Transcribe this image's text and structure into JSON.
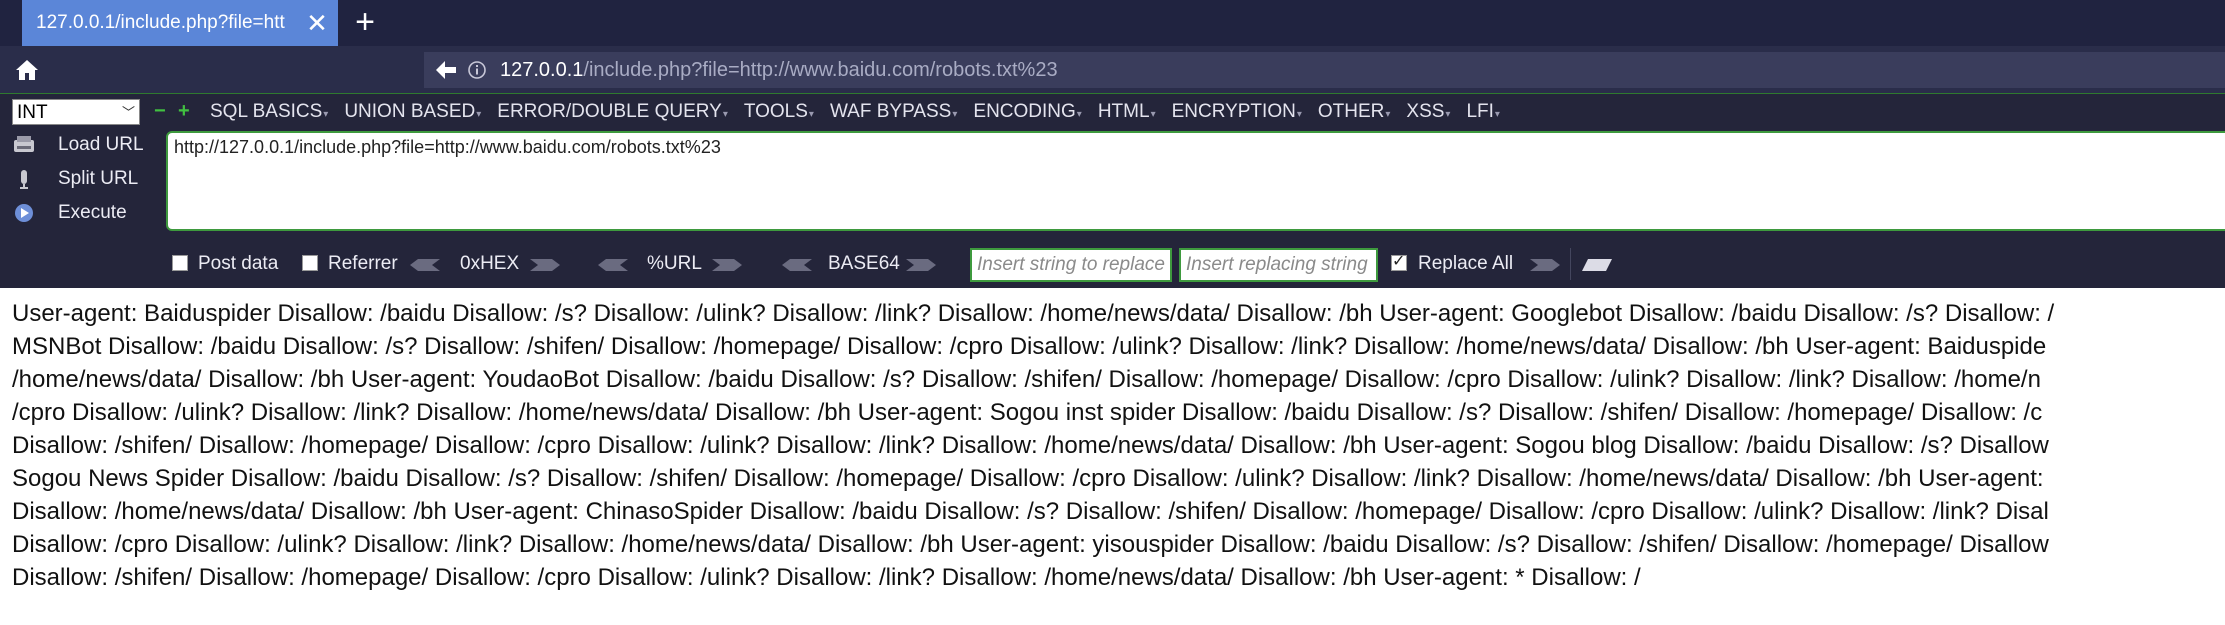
{
  "tab": {
    "title": "127.0.0.1/include.php?file=htt",
    "close": "✕"
  },
  "newtab": "+",
  "nav": {
    "url_host": "127.0.0.1",
    "url_path": "/include.php?file=http://www.baidu.com/robots.txt%23"
  },
  "hackbar": {
    "select_value": "INT",
    "minus": "−",
    "plus": "+",
    "menus": [
      "SQL BASICS",
      "UNION BASED",
      "ERROR/DOUBLE QUERY",
      "TOOLS",
      "WAF BYPASS",
      "ENCODING",
      "HTML",
      "ENCRYPTION",
      "OTHER",
      "XSS",
      "LFI"
    ],
    "load_url": "Load URL",
    "split_url": "Split URL",
    "execute": "Execute",
    "url_value": "http://127.0.0.1/include.php?file=http://www.baidu.com/robots.txt%23",
    "post_data": "Post data",
    "referrer": "Referrer",
    "hex": "0xHEX",
    "url_enc": "%URL",
    "base64": "BASE64",
    "replace_placeholder": "Insert string to replace",
    "replacing_placeholder": "Insert replacing string",
    "replace_all": "Replace All",
    "post_checked": false,
    "referrer_checked": false,
    "replace_all_checked": true
  },
  "content": {
    "lines": [
      "User-agent: Baiduspider Disallow: /baidu Disallow: /s? Disallow: /ulink? Disallow: /link? Disallow: /home/news/data/ Disallow: /bh User-agent: Googlebot Disallow: /baidu Disallow: /s? Disallow: /",
      "MSNBot Disallow: /baidu Disallow: /s? Disallow: /shifen/ Disallow: /homepage/ Disallow: /cpro Disallow: /ulink? Disallow: /link? Disallow: /home/news/data/ Disallow: /bh User-agent: Baiduspide",
      "/home/news/data/ Disallow: /bh User-agent: YoudaoBot Disallow: /baidu Disallow: /s? Disallow: /shifen/ Disallow: /homepage/ Disallow: /cpro Disallow: /ulink? Disallow: /link? Disallow: /home/n",
      "/cpro Disallow: /ulink? Disallow: /link? Disallow: /home/news/data/ Disallow: /bh User-agent: Sogou inst spider Disallow: /baidu Disallow: /s? Disallow: /shifen/ Disallow: /homepage/ Disallow: /c",
      "Disallow: /shifen/ Disallow: /homepage/ Disallow: /cpro Disallow: /ulink? Disallow: /link? Disallow: /home/news/data/ Disallow: /bh User-agent: Sogou blog Disallow: /baidu Disallow: /s? Disallow",
      "Sogou News Spider Disallow: /baidu Disallow: /s? Disallow: /shifen/ Disallow: /homepage/ Disallow: /cpro Disallow: /ulink? Disallow: /link? Disallow: /home/news/data/ Disallow: /bh User-agent:",
      "Disallow: /home/news/data/ Disallow: /bh User-agent: ChinasoSpider Disallow: /baidu Disallow: /s? Disallow: /shifen/ Disallow: /homepage/ Disallow: /cpro Disallow: /ulink? Disallow: /link? Disal",
      "Disallow: /cpro Disallow: /ulink? Disallow: /link? Disallow: /home/news/data/ Disallow: /bh User-agent: yisouspider Disallow: /baidu Disallow: /s? Disallow: /shifen/ Disallow: /homepage/ Disallow",
      "Disallow: /shifen/ Disallow: /homepage/ Disallow: /cpro Disallow: /ulink? Disallow: /link? Disallow: /home/news/data/ Disallow: /bh User-agent: * Disallow: /"
    ]
  },
  "colors": {
    "tab_active": "#5b86d8",
    "chrome_dark": "#202340",
    "accent_green": "#3e9a3e"
  }
}
